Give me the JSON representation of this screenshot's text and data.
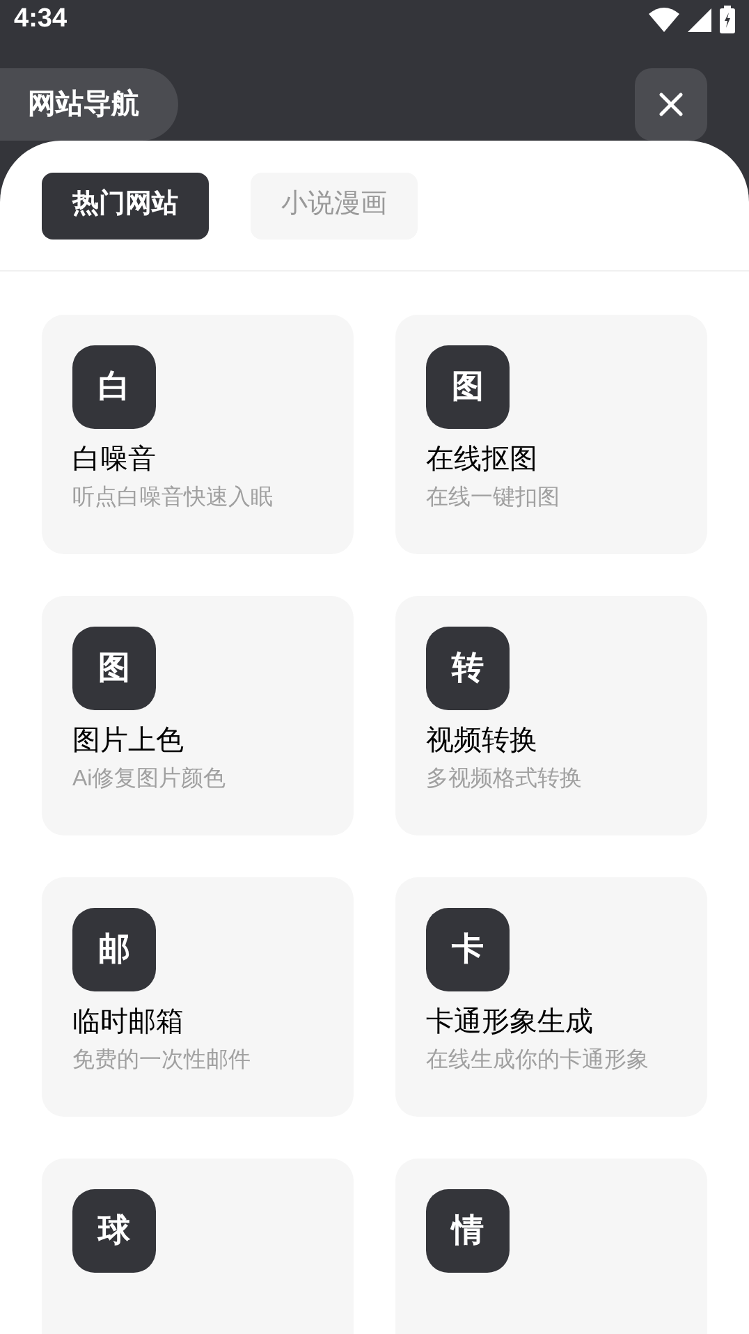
{
  "status_bar": {
    "time": "4:34"
  },
  "header": {
    "title": "网站导航"
  },
  "tabs": [
    {
      "label": "热门网站",
      "selected": true
    },
    {
      "label": "小说漫画",
      "selected": false
    }
  ],
  "sites": [
    {
      "icon_char": "白",
      "title": "白噪音",
      "subtitle": "听点白噪音快速入眠"
    },
    {
      "icon_char": "图",
      "title": "在线抠图",
      "subtitle": "在线一键扣图"
    },
    {
      "icon_char": "图",
      "title": "图片上色",
      "subtitle": "Ai修复图片颜色"
    },
    {
      "icon_char": "转",
      "title": "视频转换",
      "subtitle": "多视频格式转换"
    },
    {
      "icon_char": "邮",
      "title": "临时邮箱",
      "subtitle": "免费的一次性邮件"
    },
    {
      "icon_char": "卡",
      "title": "卡通形象生成",
      "subtitle": "在线生成你的卡通形象"
    },
    {
      "icon_char": "球"
    },
    {
      "icon_char": "情"
    }
  ]
}
